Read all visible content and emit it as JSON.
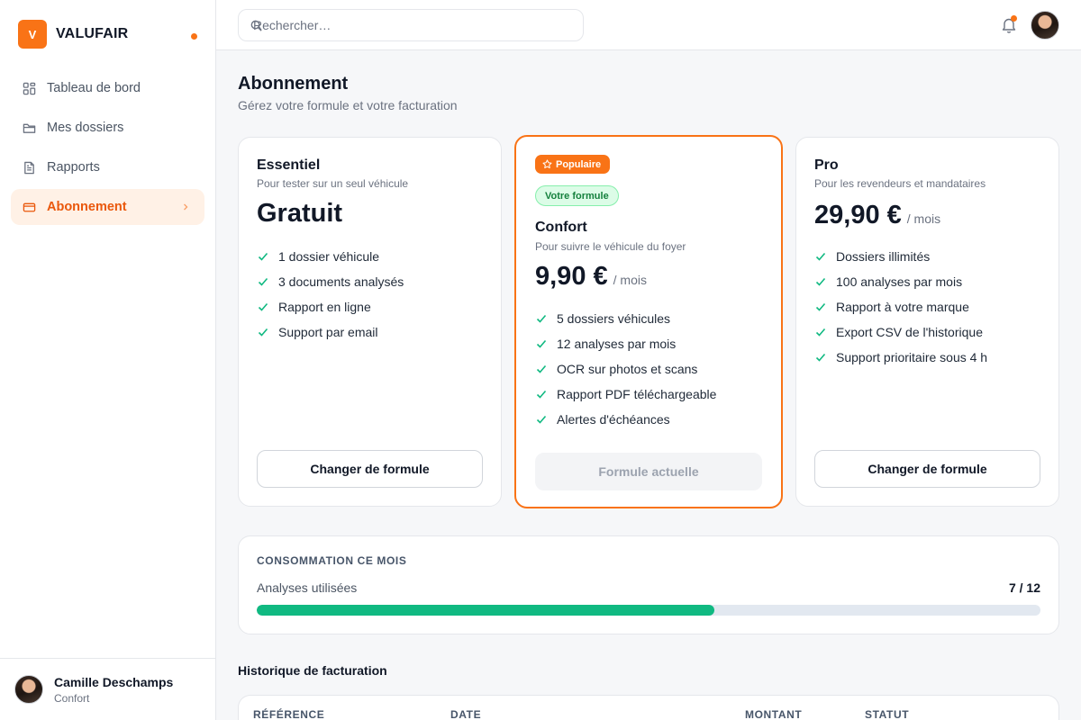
{
  "app": {
    "brand": "VALUFAIR",
    "logo_letter": "V"
  },
  "sidebar": {
    "items": [
      {
        "label": "Tableau de bord",
        "icon": "dashboard-icon"
      },
      {
        "label": "Mes dossiers",
        "icon": "folder-icon"
      },
      {
        "label": "Rapports",
        "icon": "file-text-icon"
      },
      {
        "label": "Abonnement",
        "icon": "credit-card-icon",
        "active": true
      }
    ],
    "user": {
      "name": "Camille Deschamps",
      "plan": "Confort"
    }
  },
  "topbar": {
    "search_placeholder": "Rechercher…"
  },
  "page": {
    "title": "Abonnement",
    "subtitle": "Gérez votre formule et votre facturation"
  },
  "plans": [
    {
      "name": "Essentiel",
      "description": "Pour tester sur un seul véhicule",
      "price": "Gratuit",
      "period": "",
      "features": [
        "1 dossier véhicule",
        "3 documents analysés",
        "Rapport en ligne",
        "Support par email"
      ],
      "button": "Changer de formule"
    },
    {
      "badge_popular": "Populaire",
      "badge_current": "Votre formule",
      "name": "Confort",
      "description": "Pour suivre le véhicule du foyer",
      "price": "9,90 €",
      "period": "/ mois",
      "features": [
        "5 dossiers véhicules",
        "12 analyses par mois",
        "OCR sur photos et scans",
        "Rapport PDF téléchargeable",
        "Alertes d'échéances"
      ],
      "button": "Formule actuelle"
    },
    {
      "name": "Pro",
      "description": "Pour les revendeurs et mandataires",
      "price": "29,90 €",
      "period": "/ mois",
      "features": [
        "Dossiers illimités",
        "100 analyses par mois",
        "Rapport à votre marque",
        "Export CSV de l'historique",
        "Support prioritaire sous 4 h"
      ],
      "button": "Changer de formule"
    }
  ],
  "usage": {
    "label": "CONSOMMATION CE MOIS",
    "metric": "Analyses utilisées",
    "count": "7 / 12",
    "used": 7,
    "total": 12
  },
  "billing": {
    "title": "Historique de facturation",
    "columns": [
      "RÉFÉRENCE",
      "DATE",
      "MONTANT",
      "STATUT"
    ]
  },
  "colors": {
    "accent": "#f97316",
    "success": "#10b981",
    "text": "#111827",
    "muted": "#6b7280"
  }
}
